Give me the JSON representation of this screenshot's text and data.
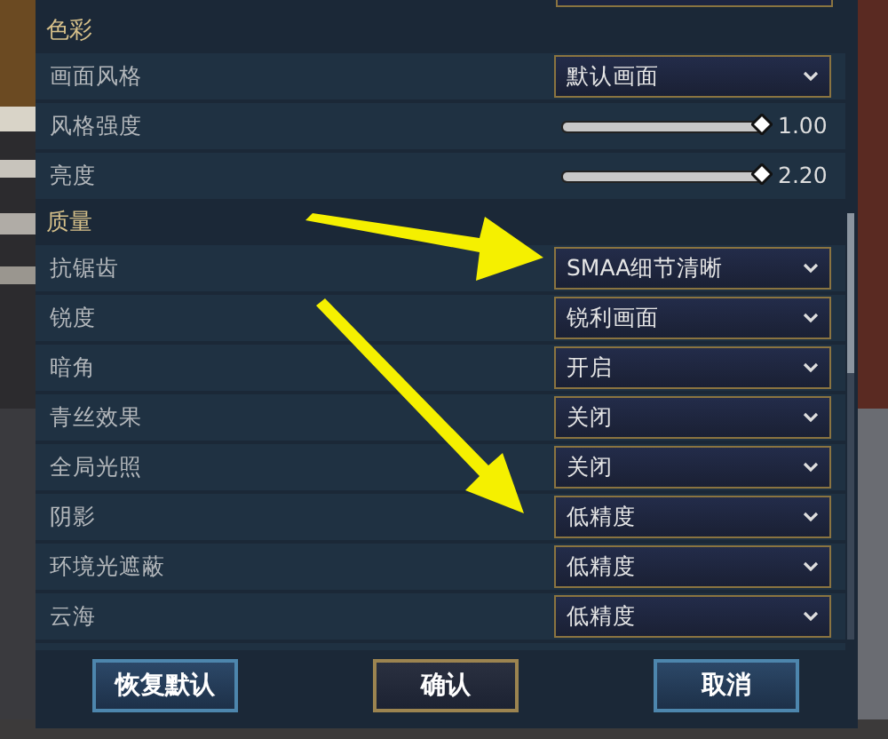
{
  "sections": [
    {
      "title": "色彩",
      "rows": [
        {
          "label": "画面风格",
          "kind": "select",
          "value": "默认画面"
        },
        {
          "label": "风格强度",
          "kind": "slider",
          "level": 0.98,
          "reading": "1.00"
        },
        {
          "label": "亮度",
          "kind": "slider",
          "level": 0.98,
          "reading": "2.20"
        }
      ]
    },
    {
      "title": "质量",
      "rows": [
        {
          "label": "抗锯齿",
          "kind": "select",
          "value": "SMAA细节清晰"
        },
        {
          "label": "锐度",
          "kind": "select",
          "value": "锐利画面"
        },
        {
          "label": "暗角",
          "kind": "select",
          "value": "开启"
        },
        {
          "label": "青丝效果",
          "kind": "select",
          "value": "关闭"
        },
        {
          "label": "全局光照",
          "kind": "select",
          "value": "关闭"
        },
        {
          "label": "阴影",
          "kind": "select",
          "value": "低精度"
        },
        {
          "label": "环境光遮蔽",
          "kind": "select",
          "value": "低精度"
        },
        {
          "label": "云海",
          "kind": "select",
          "value": "低精度"
        }
      ]
    }
  ],
  "buttons": [
    {
      "label": "恢复默认",
      "kind": "default"
    },
    {
      "label": "确认",
      "kind": "primary"
    },
    {
      "label": "取消",
      "kind": "default"
    }
  ]
}
